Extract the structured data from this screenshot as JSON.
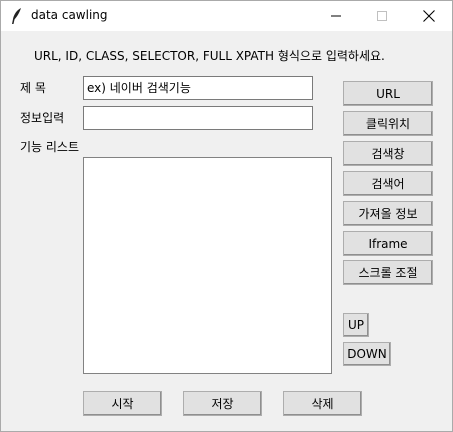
{
  "window": {
    "title": "data cawling",
    "icon": "feather-icon"
  },
  "instruction": "URL, ID, CLASS, SELECTOR, FULL XPATH 형식으로 입력하세요.",
  "form": {
    "title_label": "제 목",
    "title_value": "ex) 네이버 검색기능",
    "info_label": "정보입력",
    "info_value": "",
    "list_label": "기능 리스트",
    "list_items": []
  },
  "side_buttons": {
    "url": "URL",
    "click_position": "클릭위치",
    "search_box": "검색창",
    "search_word": "검색어",
    "get_info": "가져올 정보",
    "iframe": "Iframe",
    "scroll": "스크롤 조절",
    "up": "UP",
    "down": "DOWN"
  },
  "bottom_buttons": {
    "start": "시작",
    "save": "저장",
    "delete": "삭제"
  }
}
